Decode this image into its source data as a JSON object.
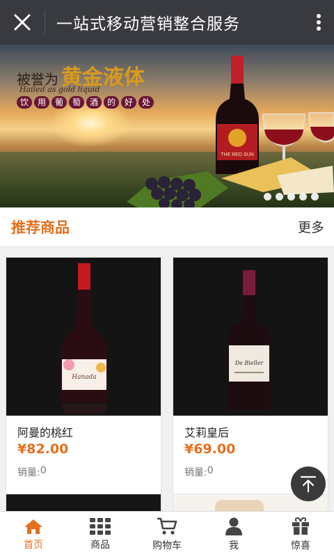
{
  "header": {
    "title": "一站式移动营销整合服务"
  },
  "banner": {
    "headline_small": "被誉为",
    "headline_big": "黄金液体",
    "subtitle_en": "Hailed as gold liquid",
    "subtitle_chars": [
      "饮",
      "用",
      "葡",
      "萄",
      "酒",
      "的",
      "好",
      "处"
    ],
    "bottle_label": "THE RED SUN",
    "dot_count": 5,
    "active_dot": 0
  },
  "section": {
    "title": "推荐商品",
    "more_label": "更多"
  },
  "products": [
    {
      "name": "阿曼的桃红",
      "price": "¥82.00",
      "sold_label": "销量:",
      "sold_value": "0",
      "label_text": "Hanada"
    },
    {
      "name": "艾莉皇后",
      "price": "¥69.00",
      "sold_label": "销量:",
      "sold_value": "0",
      "label_text": "De Bieller"
    }
  ],
  "tabbar": {
    "items": [
      {
        "label": "首页",
        "icon": "home-icon"
      },
      {
        "label": "商品",
        "icon": "grid-icon"
      },
      {
        "label": "购物车",
        "icon": "cart-icon"
      },
      {
        "label": "我",
        "icon": "user-icon"
      },
      {
        "label": "惊喜",
        "icon": "gift-icon"
      }
    ],
    "active_index": 0
  },
  "colors": {
    "accent": "#e66f1c",
    "header_bg": "#393a3f"
  }
}
